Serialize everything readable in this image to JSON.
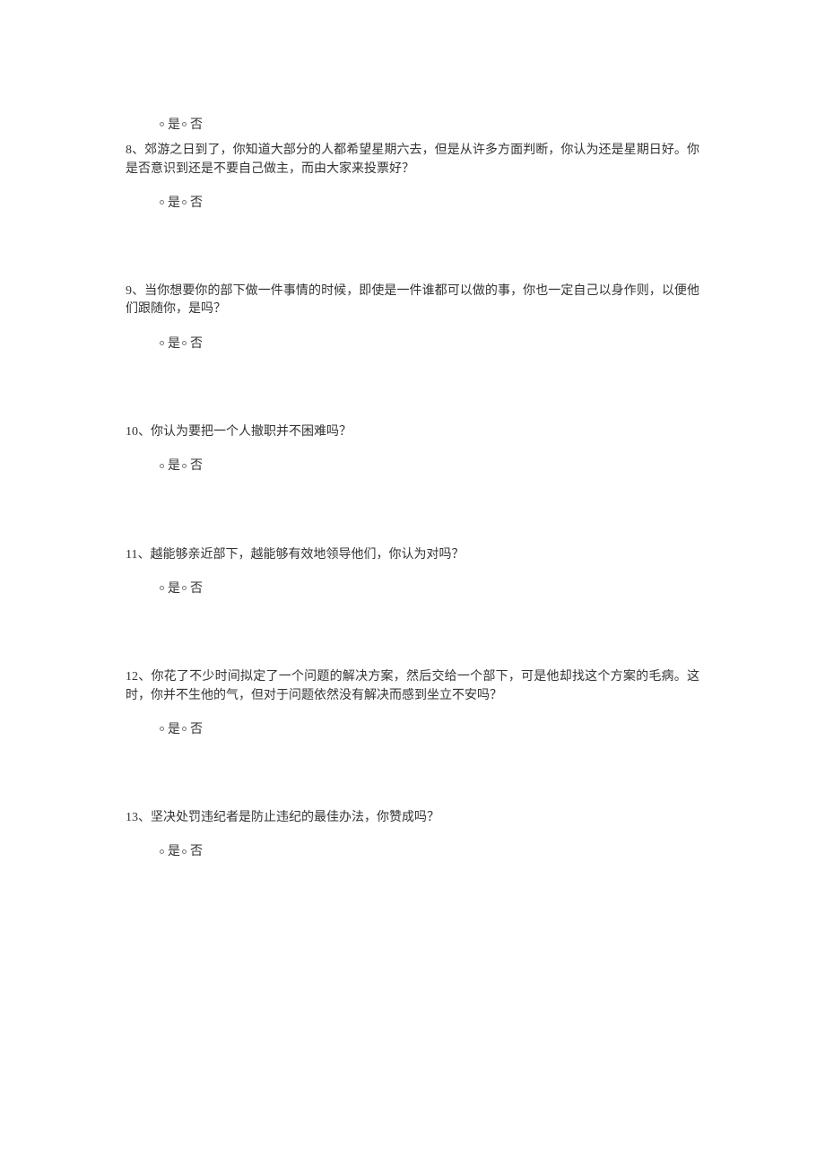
{
  "options": {
    "yes": "是",
    "no": "否"
  },
  "q7": {
    "yes": "是",
    "no": "否"
  },
  "q8": {
    "text": "8、郊游之日到了，你知道大部分的人都希望星期六去，但是从许多方面判断，你认为还是星期日好。你是否意识到还是不要自己做主，而由大家来投票好？",
    "yes": "是",
    "no": "否"
  },
  "q9": {
    "text": "9、当你想要你的部下做一件事情的时候，即使是一件谁都可以做的事，你也一定自己以身作则，以便他们跟随你，是吗？",
    "yes": "是",
    "no": "否"
  },
  "q10": {
    "text": "10、你认为要把一个人撤职并不困难吗？",
    "yes": "是",
    "no": "否"
  },
  "q11": {
    "text": "11、越能够亲近部下，越能够有效地领导他们，你认为对吗？",
    "yes": "是",
    "no": "否"
  },
  "q12": {
    "text": "12、你花了不少时间拟定了一个问题的解决方案，然后交给一个部下，可是他却找这个方案的毛病。这时，你并不生他的气，但对于问题依然没有解决而感到坐立不安吗？",
    "yes": "是",
    "no": "否"
  },
  "q13": {
    "text": "13、坚决处罚违纪者是防止违纪的最佳办法，你赞成吗？",
    "yes": "是",
    "no": "否"
  }
}
